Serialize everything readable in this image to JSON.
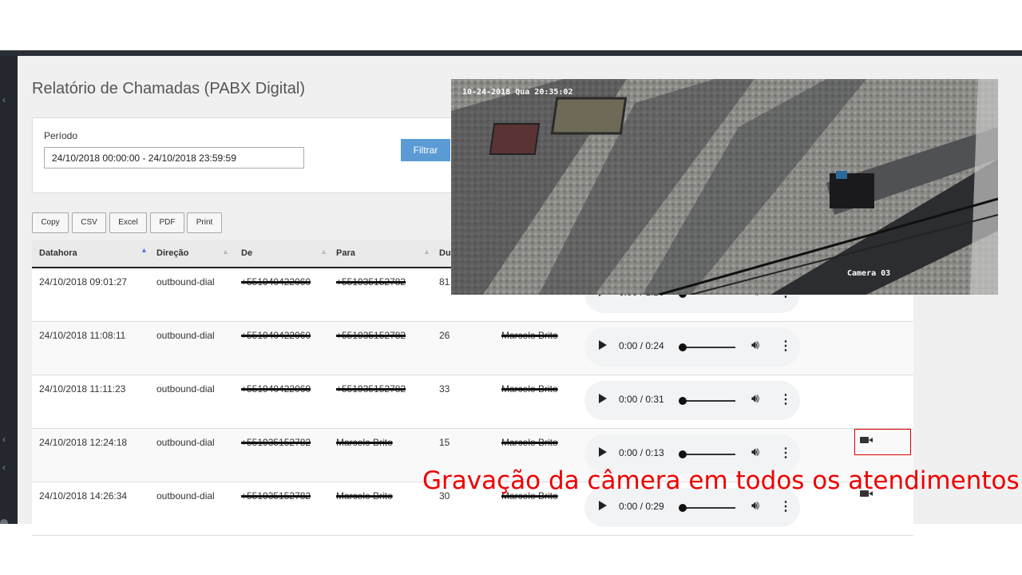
{
  "page": {
    "title": "Relatório de Chamadas (PABX Digital)"
  },
  "filter": {
    "period_label": "Período",
    "period_value": "24/10/2018 00:00:00 - 24/10/2018 23:59:59",
    "filter_button": "Filtrar"
  },
  "export_buttons": [
    "Copy",
    "CSV",
    "Excel",
    "PDF",
    "Print"
  ],
  "table": {
    "columns": [
      "Datahora",
      "Direção",
      "De",
      "Para",
      "Du"
    ],
    "rows": [
      {
        "datahora": "24/10/2018 09:01:27",
        "direcao": "outbound-dial",
        "de": "+551940422060",
        "para": "+551935152782",
        "duracao": "81",
        "agente": "",
        "audio_time": "0:00 / 1:20",
        "camera": false
      },
      {
        "datahora": "24/10/2018 11:08:11",
        "direcao": "outbound-dial",
        "de": "+551940422060",
        "para": "+551935152782",
        "duracao": "26",
        "agente": "Marcelo Brito",
        "audio_time": "0:00 / 0:24",
        "camera": false
      },
      {
        "datahora": "24/10/2018 11:11:23",
        "direcao": "outbound-dial",
        "de": "+551940422060",
        "para": "+551935152782",
        "duracao": "33",
        "agente": "Marcelo Brito",
        "audio_time": "0:00 / 0:31",
        "camera": false
      },
      {
        "datahora": "24/10/2018 12:24:18",
        "direcao": "outbound-dial",
        "de": "+551935152782",
        "para": "Marcelo Brito",
        "duracao": "15",
        "agente": "Marcelo Brito",
        "audio_time": "0:00 / 0:13",
        "camera": true
      },
      {
        "datahora": "24/10/2018 14:26:34",
        "direcao": "outbound-dial",
        "de": "+551935152782",
        "para": "Marcelo Brito",
        "duracao": "30",
        "agente": "Marcelo Brito",
        "audio_time": "0:00 / 0:29",
        "camera": true
      }
    ]
  },
  "camera": {
    "timestamp": "10-24-2018 Qua 20:35:02",
    "label": "Camera 03"
  },
  "caption": "Gravação da câmera em todos os atendimentos",
  "colors": {
    "accent": "#5b9bd5",
    "caption": "#e00000",
    "highlight_box": "#d00000"
  }
}
